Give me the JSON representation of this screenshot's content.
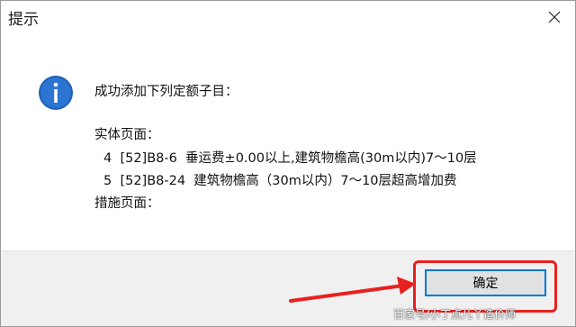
{
  "window": {
    "title": "提示",
    "close_icon": "close-icon"
  },
  "message": {
    "icon": "info-icon",
    "header": "成功添加下列定额子目：",
    "section_entity": "实体页面：",
    "items": [
      "4  [52]B8-6  垂运费±0.00以上,建筑物檐高(30m以内)7～10层",
      "5  [52]B8-24  建筑物檐高（30m以内）7～10层超高增加费"
    ],
    "section_measures": "措施页面："
  },
  "footer": {
    "ok_label": "确定"
  },
  "annotation": {
    "color": "#e8201d"
  },
  "watermark": "百家号/小丁点儿丫造价师"
}
